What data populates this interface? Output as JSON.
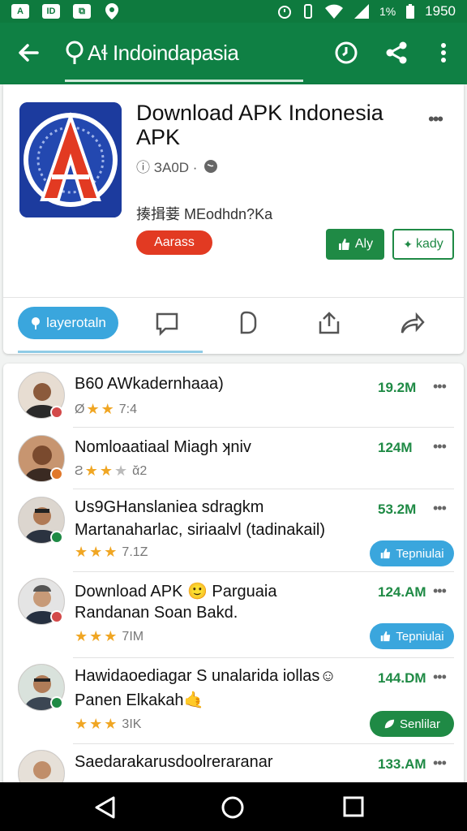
{
  "status_bar": {
    "icons": [
      "notification-a",
      "notification-id",
      "notification-app",
      "location"
    ],
    "right_icons": [
      "alarm",
      "vibrate",
      "wifi",
      "signal",
      "battery"
    ],
    "battery_text": "1%",
    "time": "1950"
  },
  "app_bar": {
    "title": "Aɬ Indoindapasia",
    "actions": [
      "timer-icon",
      "share-icon",
      "more-vert-icon"
    ]
  },
  "app_card": {
    "title": "Download APK Indonesia APK",
    "meta": "ⓘ ЗА0D ·",
    "developer": "揍揖菨 MEodhdn?Ka",
    "badge": "Aarass",
    "primary_button": "Aly",
    "secondary_button": "kady",
    "tab_pill": "layerotaln"
  },
  "list": [
    {
      "name": "B60 AWkadernhaaa)",
      "line2": "",
      "rating_text": "7:4",
      "stars": 2,
      "stars_prefix": "Ø",
      "size": "19.2M",
      "button": "",
      "dot_color": "#d34a4a"
    },
    {
      "name": "Nomloaatiaal Miagh ʞniv",
      "line2": "",
      "rating_text": "ᾰ2",
      "stars": 2,
      "stars_prefix": "Ƨ",
      "size": "124M",
      "button": "",
      "dot_color": "#e0782b"
    },
    {
      "name": "Us9GHanslaniea sdragkm",
      "line2": "Martanaharlac, siriaalvl (tadinakail)",
      "rating_text": "7.1Z",
      "stars": 3,
      "stars_prefix": "",
      "size": "53.2M",
      "button": "Tepniulai",
      "button_color": "#3aa6dd",
      "dot_color": "#1f8a45"
    },
    {
      "name": "Download APK 🙂 Parguaia",
      "line2": "Randanan Soan Bakd.",
      "rating_text": "7IM",
      "stars": 3,
      "stars_prefix": "",
      "size": "124.AM",
      "button": "Tepniulai",
      "button_color": "#3aa6dd",
      "dot_color": "#d34a4a"
    },
    {
      "name": "Hawidaoediagar S unalarida iollas☺",
      "line2": "Panen Elkakah🤙",
      "rating_text": "3IK",
      "stars": 3,
      "stars_prefix": "",
      "size": "144.DM",
      "button": "Senlilar",
      "button_color": "#1f8a45",
      "dot_color": "#1f8a45"
    },
    {
      "name": "Saedarakarusdoolreraranar",
      "line2": "",
      "rating_text": "",
      "stars": 0,
      "stars_prefix": "",
      "size": "133.AM",
      "button": "",
      "dot_color": "#888888"
    }
  ],
  "colors": {
    "status_bar": "#0e7a3e",
    "app_bar": "#0f8044",
    "accent_green": "#1f8a45",
    "accent_blue": "#3aa6dd",
    "badge_red": "#e23a22"
  },
  "nav_bar": [
    "back-icon",
    "home-icon",
    "recents-icon"
  ]
}
